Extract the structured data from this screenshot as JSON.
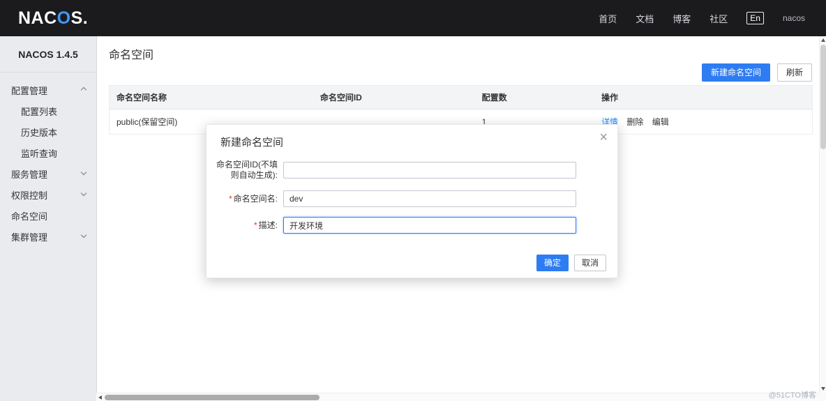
{
  "header": {
    "logo": {
      "part1": "NAC",
      "part2": "O",
      "part3": "S."
    },
    "nav": [
      {
        "label": "首页"
      },
      {
        "label": "文档"
      },
      {
        "label": "博客"
      },
      {
        "label": "社区"
      }
    ],
    "lang": "En",
    "user": "nacos"
  },
  "sidebar": {
    "version": "NACOS 1.4.5",
    "items": [
      {
        "label": "配置管理"
      },
      {
        "label": "配置列表"
      },
      {
        "label": "历史版本"
      },
      {
        "label": "监听查询"
      },
      {
        "label": "服务管理"
      },
      {
        "label": "权限控制"
      },
      {
        "label": "命名空间"
      },
      {
        "label": "集群管理"
      }
    ]
  },
  "main": {
    "title": "命名空间",
    "buttons": {
      "new": "新建命名空间",
      "refresh": "刷新"
    },
    "table": {
      "headers": [
        "命名空间名称",
        "命名空间ID",
        "配置数",
        "操作"
      ],
      "rows": [
        {
          "name": "public(保留空间)",
          "id": "",
          "count": "1",
          "actions": [
            "详情",
            "删除",
            "编辑"
          ]
        }
      ]
    }
  },
  "modal": {
    "title": "新建命名空间",
    "close": "×",
    "required_marker": "*",
    "fields": [
      {
        "label": "命名空间ID(不填则自动生成):",
        "value": ""
      },
      {
        "label": "命名空间名:",
        "value": "dev"
      },
      {
        "label": "描述:",
        "value": "开发环境"
      }
    ],
    "buttons": {
      "ok": "确定",
      "cancel": "取消"
    }
  },
  "watermark": "@51CTO博客",
  "colors": {
    "accent": "#2e7cf2",
    "header_bg": "#1b1b1d",
    "link": "#1e88ff",
    "required": "#ff3000",
    "logo_blue": "#4197f8"
  }
}
